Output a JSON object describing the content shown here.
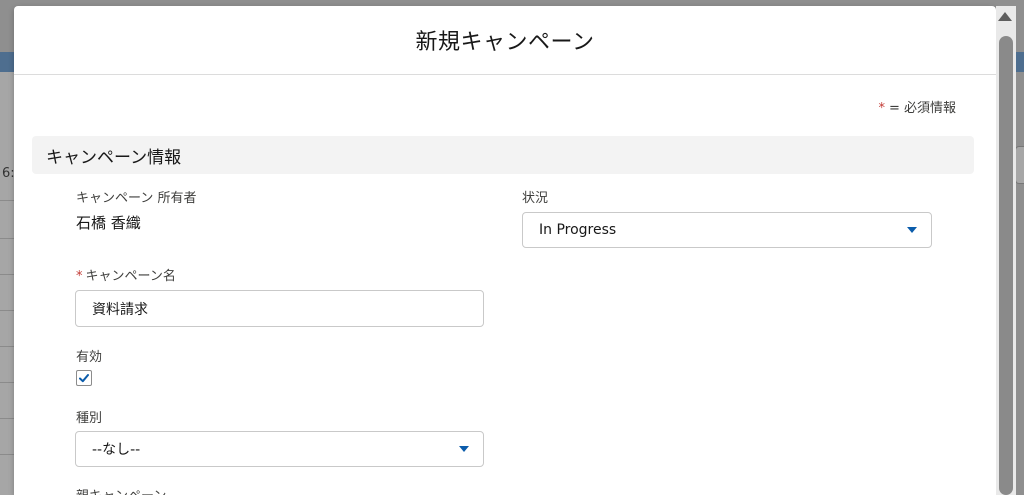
{
  "background": {
    "left_text": "6:"
  },
  "modal": {
    "title": "新規キャンペーン",
    "required_legend": {
      "asterisk": "*",
      "text": "= 必須情報"
    },
    "section": {
      "title": "キャンペーン情報"
    },
    "fields": {
      "owner": {
        "label": "キャンペーン 所有者",
        "value": "石橋 香織"
      },
      "status": {
        "label": "状況",
        "value": "In Progress"
      },
      "campaign_name": {
        "required_mark": "*",
        "label": "キャンペーン名",
        "value": "資料請求"
      },
      "active": {
        "label": "有効",
        "checked": true
      },
      "type": {
        "label": "種別",
        "value": "--なし--"
      },
      "parent_campaign": {
        "label": "親キャンペーン"
      }
    }
  },
  "colors": {
    "required": "#c23934",
    "accent": "#0b5cab",
    "section_bg": "#f3f3f3",
    "overlay": "#8f8f8f"
  }
}
